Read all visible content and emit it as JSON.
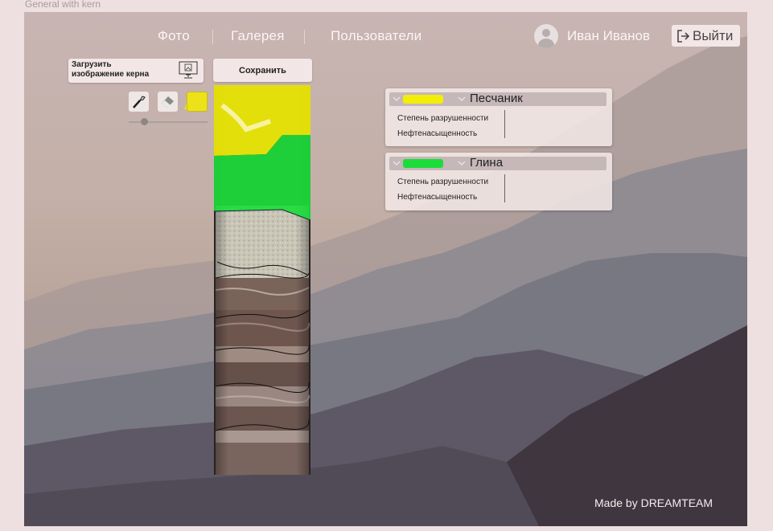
{
  "frame": {
    "label": "General with kern"
  },
  "nav": {
    "links": [
      "Фото",
      "Галерея",
      "Пользователи"
    ]
  },
  "user": {
    "name": "Иван Иванов",
    "avatar_icon": "user-avatar-icon"
  },
  "logout": {
    "label": "Выйти",
    "icon": "logout-icon"
  },
  "upload": {
    "label": "Загрузить\nизображение керна",
    "icon": "image-upload-icon"
  },
  "save": {
    "label": "Сохранить"
  },
  "tools": {
    "brush_icon": "brush-icon",
    "eraser_icon": "eraser-icon",
    "active_color": "#ede11a",
    "brush_size_fraction": 0.2
  },
  "layers": [
    {
      "name": "Песчаник",
      "color": "#f2ee07",
      "props": [
        "Степень разрушенности",
        "Нефтенасыщенность"
      ]
    },
    {
      "name": "Глина",
      "color": "#1ddc3a",
      "props": [
        "Степень разрушенности",
        "Нефтенасыщенность"
      ]
    }
  ],
  "footer": {
    "credit": "Made by DREAMTEAM"
  }
}
